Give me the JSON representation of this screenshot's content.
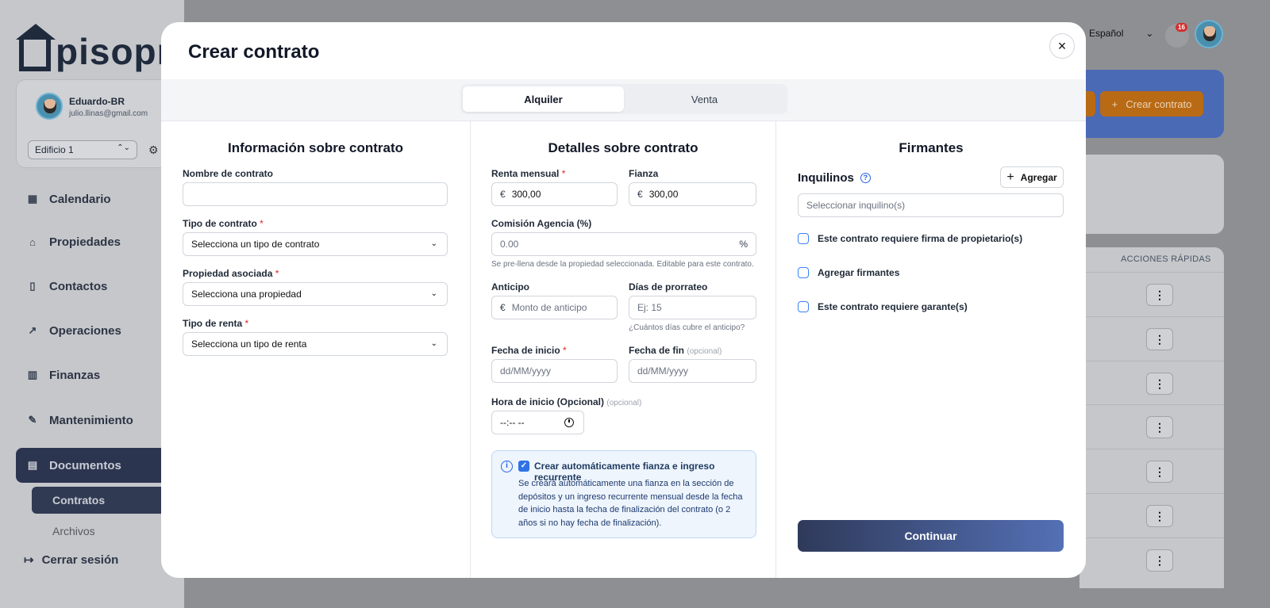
{
  "background": {
    "brand": "pisopro",
    "user": {
      "name": "Eduardo-BR",
      "email": "julio.llinas@gmail.com"
    },
    "building_select": "Edificio 1",
    "nav": [
      "Calendario",
      "Propiedades",
      "Contactos",
      "Operaciones",
      "Finanzas",
      "Mantenimiento",
      "Documentos"
    ],
    "subnav": [
      "Contratos",
      "Archivos"
    ],
    "logout": "Cerrar sesión",
    "language": "Español",
    "notifications": "16",
    "create_button": "Crear contrato",
    "table_header": "ACCIONES RÁPIDAS",
    "kebab": "⋮"
  },
  "modal": {
    "title": "Crear contrato",
    "close": "×",
    "tabs": [
      "Alquiler",
      "Venta"
    ],
    "info": {
      "title": "Información sobre contrato",
      "name_label": "Nombre de contrato",
      "type_label": "Tipo de contrato",
      "type_value": "Selecciona un tipo de contrato",
      "property_label": "Propiedad asociada",
      "property_value": "Selecciona una propiedad",
      "rent_type_label": "Tipo de renta",
      "rent_type_value": "Selecciona un tipo de renta"
    },
    "details": {
      "title": "Detalles sobre contrato",
      "rent_label": "Renta mensual",
      "rent_value": "300,00",
      "deposit_label": "Fianza",
      "deposit_value": "300,00",
      "currency": "€",
      "commission_label": "Comisión Agencia (%)",
      "commission_value": "0.00",
      "percent": "%",
      "commission_help": "Se pre-llena desde la propiedad seleccionada. Editable para este contrato.",
      "advance_label": "Anticipo",
      "advance_placeholder": "Monto de anticipo",
      "prorate_label": "Días de prorrateo",
      "prorate_placeholder": "Ej: 15",
      "prorate_help": "¿Cuántos días cubre el anticipo?",
      "start_label": "Fecha de inicio",
      "start_placeholder": "dd/MM/yyyy",
      "end_label": "Fecha de fin",
      "end_optional": "(opcional)",
      "end_placeholder": "dd/MM/yyyy",
      "time_label": "Hora de inicio (Opcional)",
      "time_optional": "(opcional)",
      "time_placeholder": "--:-- --",
      "auto_title": "Crear automáticamente fianza e ingreso recurrente",
      "auto_text": "Se creará automáticamente una fianza en la sección de depósitos y un ingreso recurrente mensual desde la fecha de inicio hasta la fecha de finalización del contrato (o 2 años si no hay fecha de finalización)."
    },
    "signers": {
      "title": "Firmantes",
      "tenants_label": "Inquilinos",
      "add_label": "Agregar",
      "tenant_placeholder": "Seleccionar inquilino(s)",
      "options": [
        "Este contrato requiere firma de propietario(s)",
        "Agregar firmantes",
        "Este contrato requiere garante(s)"
      ]
    },
    "continue_label": "Continuar"
  },
  "colors": {
    "accent": "#2f73e6",
    "primary_dark": "#2f3a5a",
    "primary_light": "#5470b5",
    "required": "#dc2626"
  }
}
